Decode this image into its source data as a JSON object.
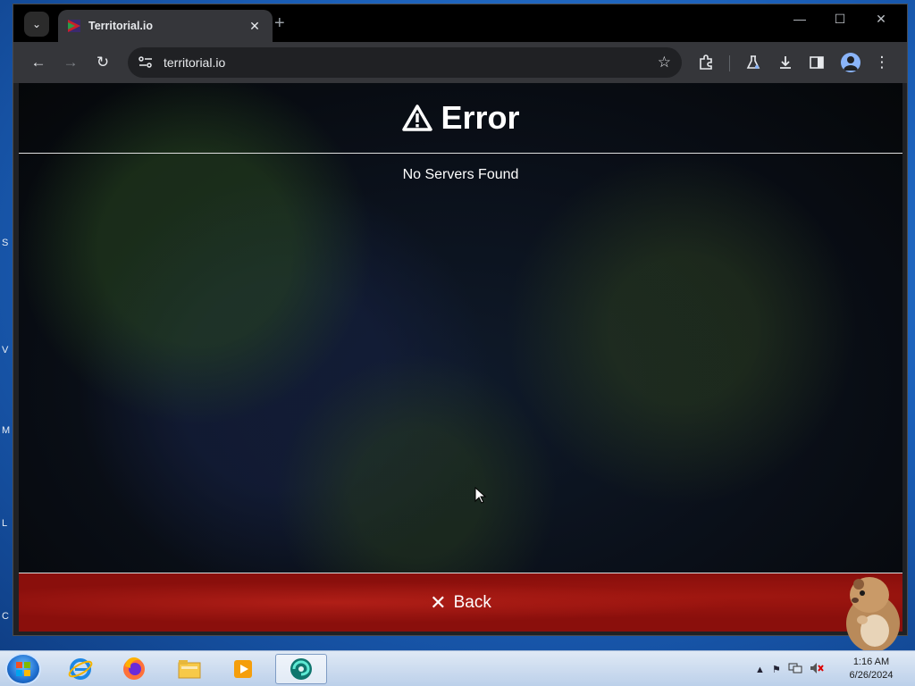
{
  "desktop": {
    "edge_letters": [
      "S",
      "V",
      "M",
      "L",
      "C"
    ]
  },
  "browser": {
    "tab": {
      "title": "Territorial.io",
      "close": "✕"
    },
    "new_tab": "+",
    "window_controls": {
      "minimize": "—",
      "maximize": "☐",
      "close": "✕"
    },
    "address": {
      "url": "territorial.io"
    }
  },
  "page": {
    "error_title": "Error",
    "error_message": "No Servers Found",
    "back_label": "Back",
    "back_color": "#8a0f0c"
  },
  "taskbar": {
    "clock": {
      "time": "1:16 AM",
      "date": "6/26/2024"
    }
  }
}
